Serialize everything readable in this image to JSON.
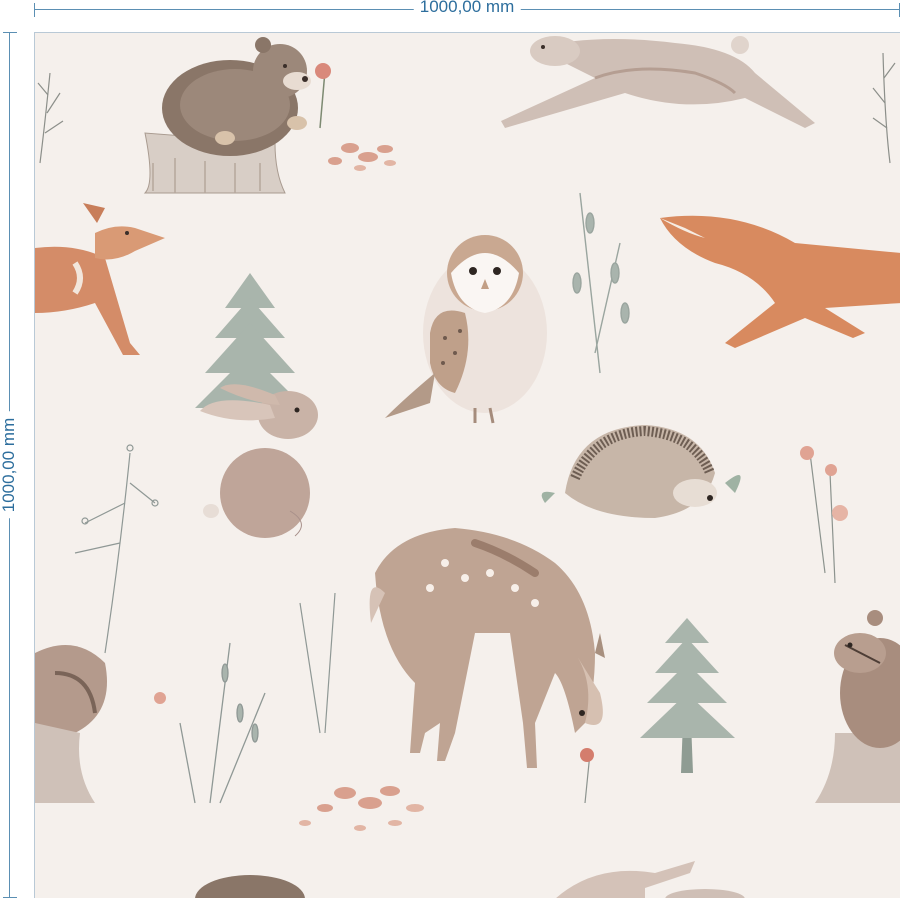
{
  "dimensions": {
    "width_label": "1000,00 mm",
    "height_label": "1000,00 mm"
  },
  "pattern": {
    "background_color": "#f5f0ec",
    "line_color": "#2d6e9d",
    "motifs": [
      "bear-icon",
      "hare-icon",
      "fox-icon",
      "owl-icon",
      "fir-tree-icon",
      "rabbit-icon",
      "hedgehog-icon",
      "deer-icon",
      "chipmunk-icon",
      "squirrel-icon",
      "mushroom-icon",
      "wildflower-icon",
      "pebbles-icon"
    ]
  }
}
